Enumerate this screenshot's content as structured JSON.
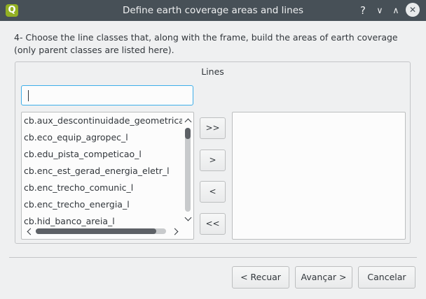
{
  "window": {
    "title": "Define earth coverage areas and lines",
    "icon_letter": "Q",
    "controls": {
      "help": "?",
      "minimize": "∨",
      "maximize": "∧",
      "close": "✕"
    }
  },
  "instruction": "4- Choose the line classes that, along with the frame, build the areas of earth coverage (only parent classes are listed here).",
  "group": {
    "title": "Lines",
    "filter": {
      "value": "",
      "placeholder": ""
    },
    "available": [
      "cb.aux_descontinuidade_geometrica",
      "cb.eco_equip_agropec_l",
      "cb.edu_pista_competicao_l",
      "cb.enc_est_gerad_energia_eletr_l",
      "cb.enc_trecho_comunic_l",
      "cb.enc_trecho_energia_l",
      "cb.hid_banco_areia_l"
    ],
    "selected": [],
    "move_buttons": {
      "add_all": ">>",
      "add": ">",
      "remove": "<",
      "remove_all": "<<"
    }
  },
  "buttons": {
    "back": "< Recuar",
    "next": "Avançar >",
    "cancel": "Cancelar"
  }
}
